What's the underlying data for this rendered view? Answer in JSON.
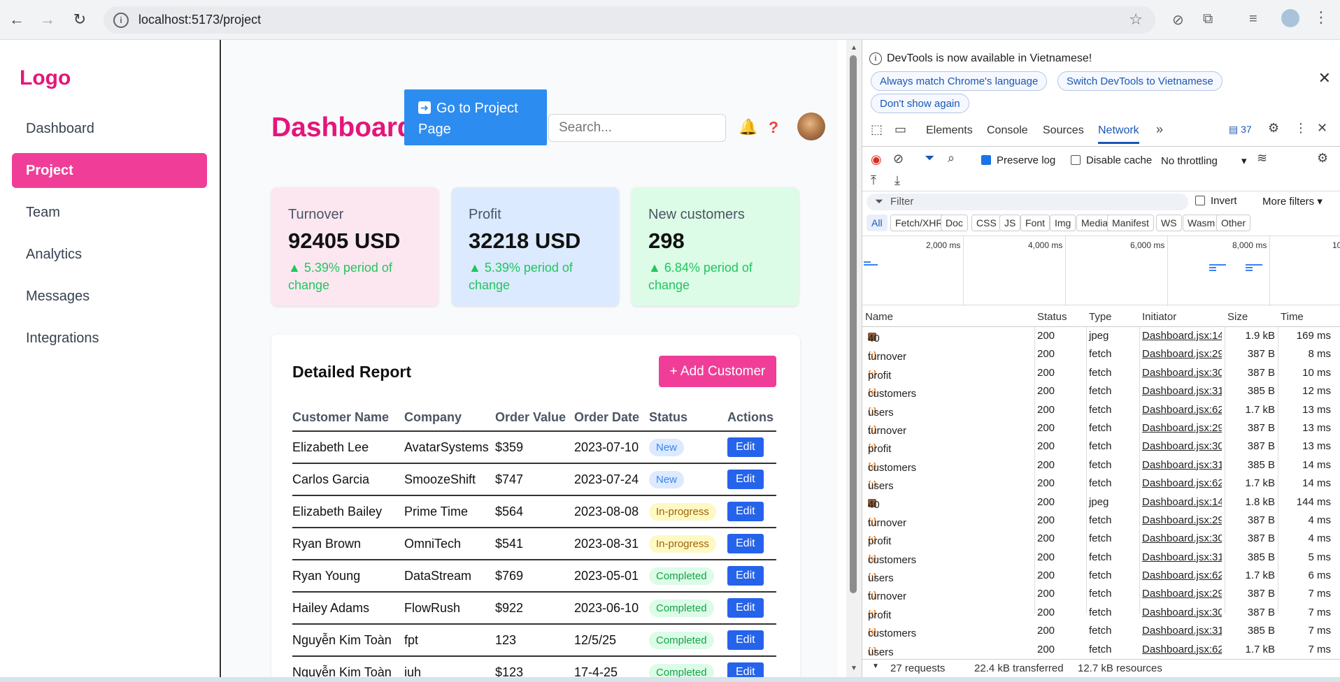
{
  "browser": {
    "url": "localhost:5173/project"
  },
  "sidebar": {
    "logo": "Logo",
    "items": [
      {
        "label": "Dashboard"
      },
      {
        "label": "Project"
      },
      {
        "label": "Team"
      },
      {
        "label": "Analytics"
      },
      {
        "label": "Messages"
      },
      {
        "label": "Integrations"
      }
    ],
    "active_item": "Project"
  },
  "header": {
    "title": "Dashboard",
    "goto_button": "Go to Project Page",
    "search_placeholder": "Search..."
  },
  "cards": [
    {
      "label": "Turnover",
      "value": "92405 USD",
      "change": "▲ 5.39% period of change",
      "color": "#fce7f1"
    },
    {
      "label": "Profit",
      "value": "32218 USD",
      "change": "▲ 5.39% period of change",
      "color": "#dbeafe"
    },
    {
      "label": "New customers",
      "value": "298",
      "change": "▲ 6.84% period of change",
      "color": "#dcfce7"
    }
  ],
  "report": {
    "title": "Detailed Report",
    "add_button": "+ Add Customer",
    "columns": [
      "Customer Name",
      "Company",
      "Order Value",
      "Order Date",
      "Status",
      "Actions"
    ],
    "rows": [
      {
        "name": "Elizabeth Lee",
        "company": "AvatarSystems",
        "value": "$359",
        "date": "2023-07-10",
        "status": "New",
        "action": "Edit"
      },
      {
        "name": "Carlos Garcia",
        "company": "SmoozeShift",
        "value": "$747",
        "date": "2023-07-24",
        "status": "New",
        "action": "Edit"
      },
      {
        "name": "Elizabeth Bailey",
        "company": "Prime Time",
        "value": "$564",
        "date": "2023-08-08",
        "status": "In-progress",
        "action": "Edit"
      },
      {
        "name": "Ryan Brown",
        "company": "OmniTech",
        "value": "$541",
        "date": "2023-08-31",
        "status": "In-progress",
        "action": "Edit"
      },
      {
        "name": "Ryan Young",
        "company": "DataStream",
        "value": "$769",
        "date": "2023-05-01",
        "status": "Completed",
        "action": "Edit"
      },
      {
        "name": "Hailey Adams",
        "company": "FlowRush",
        "value": "$922",
        "date": "2023-06-10",
        "status": "Completed",
        "action": "Edit"
      },
      {
        "name": "Nguyễn Kim Toàn",
        "company": "fpt",
        "value": "123",
        "date": "12/5/25",
        "status": "Completed",
        "action": "Edit"
      },
      {
        "name": "Nguyễn Kim Toàn",
        "company": "iuh",
        "value": "$123",
        "date": "17-4-25",
        "status": "Completed",
        "action": "Edit"
      }
    ]
  },
  "devtools": {
    "banner_text": "DevTools is now available in Vietnamese!",
    "banner_buttons": [
      "Always match Chrome's language",
      "Switch DevTools to Vietnamese",
      "Don't show again"
    ],
    "tabs": [
      "Elements",
      "Console",
      "Sources",
      "Network"
    ],
    "active_tab": "Network",
    "issues_count": "37",
    "preserve_log": "Preserve log",
    "disable_cache": "Disable cache",
    "throttling": "No throttling",
    "filter_placeholder": "Filter",
    "invert": "Invert",
    "more_filters": "More filters",
    "type_filters": [
      "All",
      "Fetch/XHR",
      "Doc",
      "CSS",
      "JS",
      "Font",
      "Img",
      "Media",
      "Manifest",
      "WS",
      "Wasm",
      "Other"
    ],
    "timeline_ticks": [
      "2,000 ms",
      "4,000 ms",
      "6,000 ms",
      "8,000 ms",
      "10"
    ],
    "columns": [
      "Name",
      "Status",
      "Type",
      "Initiator",
      "Size",
      "Time"
    ],
    "requests": [
      {
        "name": "40",
        "status": "200",
        "type": "jpeg",
        "initiator": "Dashboard.jsx:140",
        "size": "1.9 kB",
        "time": "169 ms"
      },
      {
        "name": "turnover",
        "status": "200",
        "type": "fetch",
        "initiator": "Dashboard.jsx:29",
        "size": "387 B",
        "time": "8 ms"
      },
      {
        "name": "profit",
        "status": "200",
        "type": "fetch",
        "initiator": "Dashboard.jsx:30",
        "size": "387 B",
        "time": "10 ms"
      },
      {
        "name": "customers",
        "status": "200",
        "type": "fetch",
        "initiator": "Dashboard.jsx:31",
        "size": "385 B",
        "time": "12 ms"
      },
      {
        "name": "users",
        "status": "200",
        "type": "fetch",
        "initiator": "Dashboard.jsx:62",
        "size": "1.7 kB",
        "time": "13 ms"
      },
      {
        "name": "turnover",
        "status": "200",
        "type": "fetch",
        "initiator": "Dashboard.jsx:29",
        "size": "387 B",
        "time": "13 ms"
      },
      {
        "name": "profit",
        "status": "200",
        "type": "fetch",
        "initiator": "Dashboard.jsx:30",
        "size": "387 B",
        "time": "13 ms"
      },
      {
        "name": "customers",
        "status": "200",
        "type": "fetch",
        "initiator": "Dashboard.jsx:31",
        "size": "385 B",
        "time": "14 ms"
      },
      {
        "name": "users",
        "status": "200",
        "type": "fetch",
        "initiator": "Dashboard.jsx:62",
        "size": "1.7 kB",
        "time": "14 ms"
      },
      {
        "name": "40",
        "status": "200",
        "type": "jpeg",
        "initiator": "Dashboard.jsx:140",
        "size": "1.8 kB",
        "time": "144 ms"
      },
      {
        "name": "turnover",
        "status": "200",
        "type": "fetch",
        "initiator": "Dashboard.jsx:29",
        "size": "387 B",
        "time": "4 ms"
      },
      {
        "name": "profit",
        "status": "200",
        "type": "fetch",
        "initiator": "Dashboard.jsx:30",
        "size": "387 B",
        "time": "4 ms"
      },
      {
        "name": "customers",
        "status": "200",
        "type": "fetch",
        "initiator": "Dashboard.jsx:31",
        "size": "385 B",
        "time": "5 ms"
      },
      {
        "name": "users",
        "status": "200",
        "type": "fetch",
        "initiator": "Dashboard.jsx:62",
        "size": "1.7 kB",
        "time": "6 ms"
      },
      {
        "name": "turnover",
        "status": "200",
        "type": "fetch",
        "initiator": "Dashboard.jsx:29",
        "size": "387 B",
        "time": "7 ms"
      },
      {
        "name": "profit",
        "status": "200",
        "type": "fetch",
        "initiator": "Dashboard.jsx:30",
        "size": "387 B",
        "time": "7 ms"
      },
      {
        "name": "customers",
        "status": "200",
        "type": "fetch",
        "initiator": "Dashboard.jsx:31",
        "size": "385 B",
        "time": "7 ms"
      },
      {
        "name": "users",
        "status": "200",
        "type": "fetch",
        "initiator": "Dashboard.jsx:62",
        "size": "1.7 kB",
        "time": "7 ms"
      }
    ],
    "summary": {
      "requests": "27 requests",
      "transferred": "22.4 kB transferred",
      "resources": "12.7 kB resources"
    }
  }
}
